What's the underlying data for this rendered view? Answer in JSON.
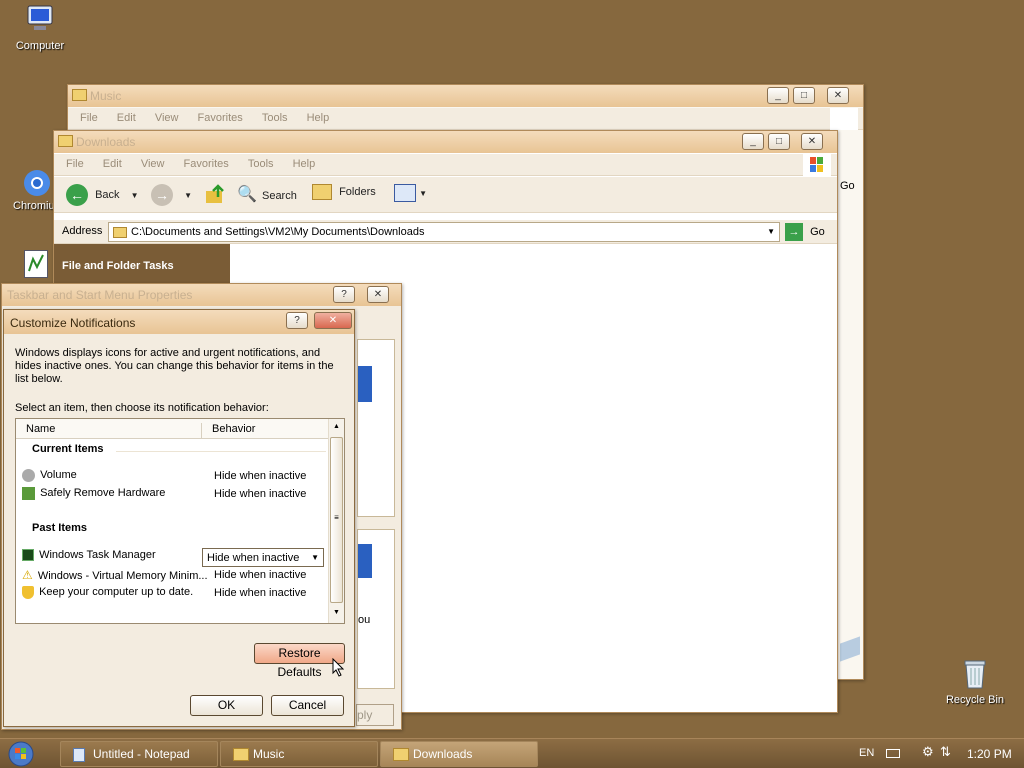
{
  "desktop": {
    "computer_label": "Computer",
    "chromium_label": "Chromium",
    "recycle_label": "Recycle Bin"
  },
  "music_window": {
    "title": "Music",
    "menu": [
      "File",
      "Edit",
      "View",
      "Favorites",
      "Tools",
      "Help"
    ],
    "partial_text": "Go"
  },
  "downloads_window": {
    "title": "Downloads",
    "menu": [
      "File",
      "Edit",
      "View",
      "Favorites",
      "Tools",
      "Help"
    ],
    "toolbar": {
      "back": "Back",
      "search": "Search",
      "folders": "Folders"
    },
    "address_label": "Address",
    "address_value": "C:\\Documents and Settings\\VM2\\My Documents\\Downloads",
    "go_label": "Go",
    "tasks_header": "File and Folder Tasks"
  },
  "taskbar_props": {
    "title": "Taskbar and Start Menu Properties",
    "partial_text": "ou",
    "apply_partial": "ply"
  },
  "customize": {
    "title": "Customize Notifications",
    "description": "Windows displays icons for active and urgent notifications, and hides inactive ones. You can change this behavior for items in the list below.",
    "instruction": "Select an item, then choose its notification behavior:",
    "columns": {
      "name": "Name",
      "behavior": "Behavior"
    },
    "current_header": "Current Items",
    "current_items": [
      {
        "name": "Volume",
        "behavior": "Hide when inactive"
      },
      {
        "name": "Safely Remove Hardware",
        "behavior": "Hide when inactive"
      }
    ],
    "past_header": "Past Items",
    "past_items": [
      {
        "name": "Windows Task Manager",
        "behavior": "Hide when inactive"
      },
      {
        "name": "Windows - Virtual Memory Minim...",
        "behavior": "Hide when inactive"
      },
      {
        "name": "Keep your computer up to date.",
        "behavior": "Hide when inactive"
      }
    ],
    "restore_label": "Restore Defaults",
    "ok_label": "OK",
    "cancel_label": "Cancel"
  },
  "taskbar": {
    "items": [
      "Untitled - Notepad",
      "Music",
      "Downloads"
    ],
    "lang": "EN",
    "clock": "1:20 PM"
  },
  "colors": {
    "desktop": "#86683e",
    "title_active": "#e8c494",
    "taskbar": "#7d6039"
  }
}
